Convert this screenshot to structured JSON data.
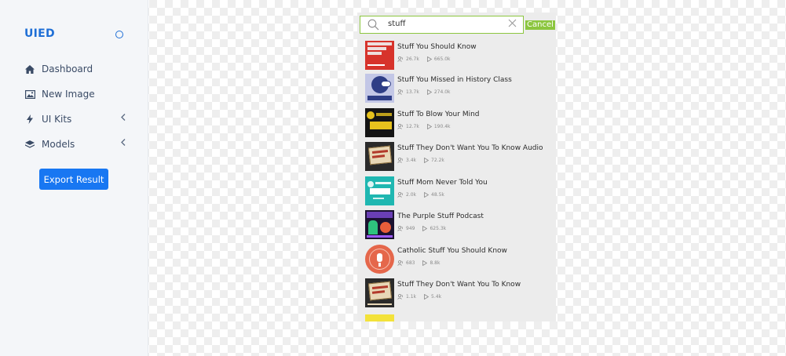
{
  "sidebar": {
    "brand": "UIED",
    "items": [
      {
        "label": "Dashboard",
        "icon": "home-icon"
      },
      {
        "label": "New Image",
        "icon": "image-icon"
      },
      {
        "label": "UI Kits",
        "icon": "bolt-icon",
        "has_submenu": true
      },
      {
        "label": "Models",
        "icon": "layers-icon",
        "has_submenu": true
      }
    ],
    "export_label": "Export Result"
  },
  "search": {
    "value": "stuff",
    "cancel_label": "Cancel"
  },
  "results": [
    {
      "title": "Stuff You Should Know",
      "subs": "26.7k",
      "plays": "665.0k"
    },
    {
      "title": "Stuff You Missed in History Class",
      "subs": "13.7k",
      "plays": "274.0k"
    },
    {
      "title": "Stuff To Blow Your Mind",
      "subs": "12.7k",
      "plays": "190.4k"
    },
    {
      "title": "Stuff They Don't Want You To Know Audio",
      "subs": "3.4k",
      "plays": "72.2k"
    },
    {
      "title": "Stuff Mom Never Told You",
      "subs": "2.0k",
      "plays": "48.5k"
    },
    {
      "title": "The Purple Stuff Podcast",
      "subs": "949",
      "plays": "625.3k"
    },
    {
      "title": "Catholic Stuff You Should Know",
      "subs": "683",
      "plays": "8.8k"
    },
    {
      "title": "Stuff They Don't Want You To Know",
      "subs": "1.1k",
      "plays": "5.4k"
    }
  ],
  "colors": {
    "accent": "#1877f2",
    "search_border": "#8cc63f",
    "panel_bg": "#ececec"
  }
}
